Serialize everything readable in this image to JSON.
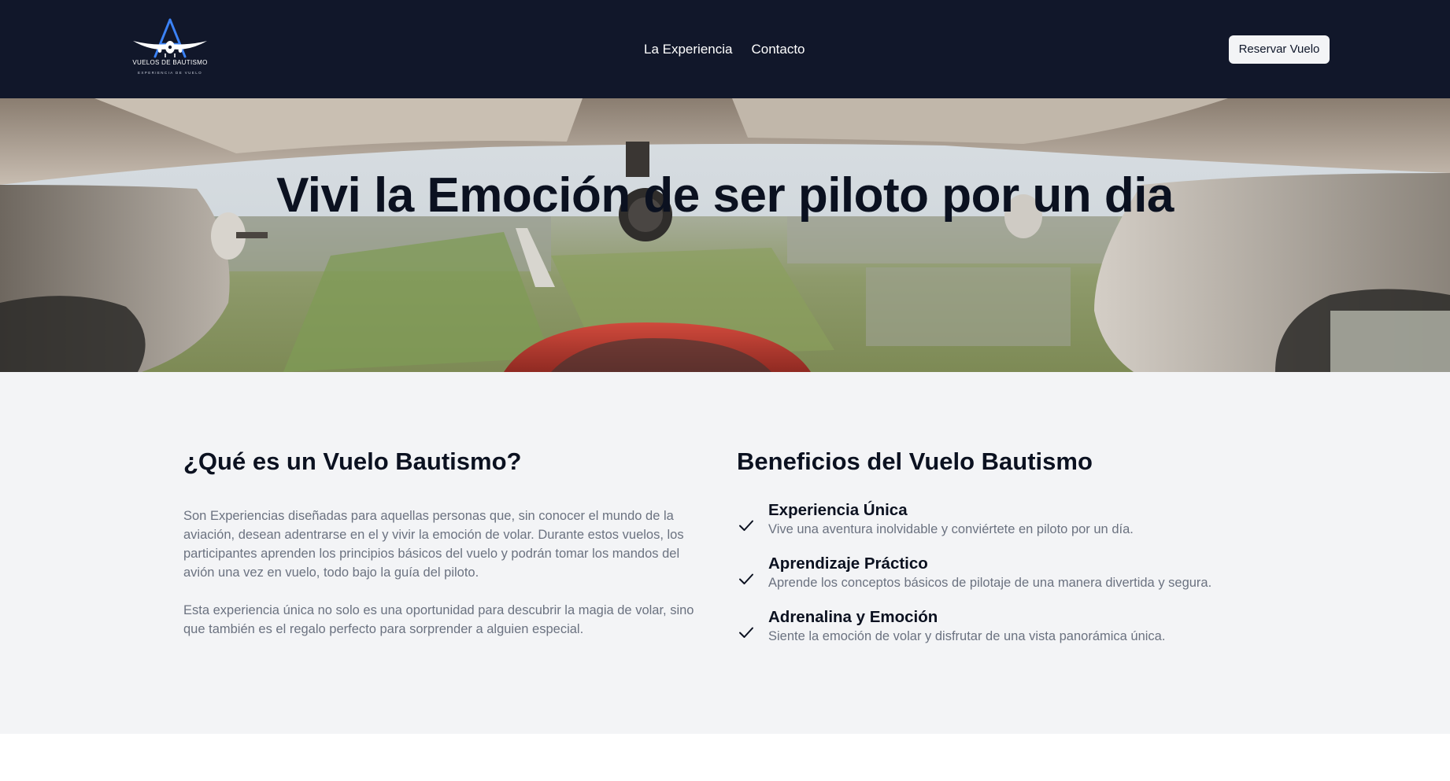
{
  "header": {
    "logo": {
      "title": "VUELOS DE BAUTISMO",
      "subtitle": "EXPERIENCIA DE VUELO",
      "icon": "airplane-logo-icon"
    },
    "nav": [
      {
        "label": "La Experiencia"
      },
      {
        "label": "Contacto"
      }
    ],
    "cta_label": "Reservar Vuelo"
  },
  "hero": {
    "title": "Vivi la Emoción de ser piloto por un dia"
  },
  "about": {
    "title": "¿Qué es un Vuelo Bautismo?",
    "paragraph1": "Son Experiencias diseñadas para aquellas personas que, sin conocer el mundo de la aviación, desean adentrarse en el y vivir la emoción de volar. Durante estos vuelos, los participantes aprenden los principios básicos del vuelo y podrán tomar los mandos del avión una vez en vuelo, todo bajo la guía del piloto.",
    "paragraph2": "Esta experiencia única no solo es una oportunidad para descubrir la magia de volar, sino que también es el regalo perfecto para sorprender a alguien especial."
  },
  "benefits": {
    "title": "Beneficios del Vuelo Bautismo",
    "items": [
      {
        "title": "Experiencia Única",
        "desc": "Vive una aventura inolvidable y conviértete en piloto por un día.",
        "icon": "check-icon"
      },
      {
        "title": "Aprendizaje Práctico",
        "desc": "Aprende los conceptos básicos de pilotaje de una manera divertida y segura.",
        "icon": "check-icon"
      },
      {
        "title": "Adrenalina y Emoción",
        "desc": "Siente la emoción de volar y disfrutar de una vista panorámica única.",
        "icon": "check-icon"
      }
    ]
  },
  "colors": {
    "header_bg": "#11172a",
    "content_bg": "#f3f4f6",
    "muted_text": "#6b7280",
    "logo_accent": "#3b82f6"
  }
}
